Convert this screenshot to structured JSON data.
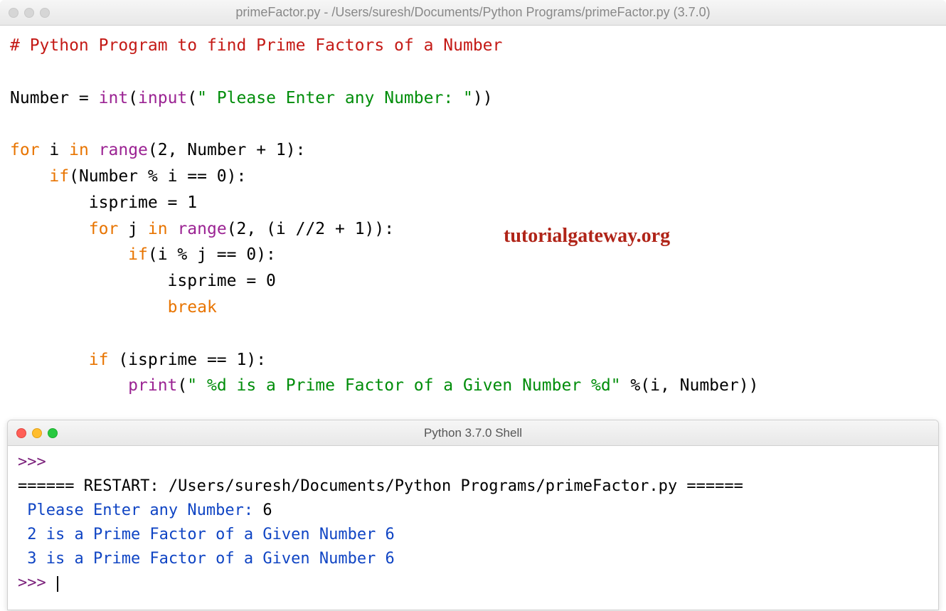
{
  "editor": {
    "title": "primeFactor.py - /Users/suresh/Documents/Python Programs/primeFactor.py (3.7.0)",
    "code": {
      "comment": "# Python Program to find Prime Factors of a Number",
      "l3_a": "Number = ",
      "l3_b": "int",
      "l3_c": "(",
      "l3_d": "input",
      "l3_e": "(",
      "l3_f": "\" Please Enter any Number: \"",
      "l3_g": "))",
      "l5_a": "for",
      "l5_b": " i ",
      "l5_c": "in",
      "l5_d": " ",
      "l5_e": "range",
      "l5_f": "(2, Number + 1):",
      "l6_a": "    ",
      "l6_b": "if",
      "l6_c": "(Number % i == 0):",
      "l7": "        isprime = 1",
      "l8_a": "        ",
      "l8_b": "for",
      "l8_c": " j ",
      "l8_d": "in",
      "l8_e": " ",
      "l8_f": "range",
      "l8_g": "(2, (i //2 + 1)):",
      "l9_a": "            ",
      "l9_b": "if",
      "l9_c": "(i % j == 0):",
      "l10": "                isprime = 0",
      "l11_a": "                ",
      "l11_b": "break",
      "l13_a": "        ",
      "l13_b": "if",
      "l13_c": " (isprime == 1):",
      "l14_a": "            ",
      "l14_b": "print",
      "l14_c": "(",
      "l14_d": "\" %d is a Prime Factor of a Given Number %d\"",
      "l14_e": " %(i, Number))"
    }
  },
  "shell": {
    "title": "Python 3.7.0 Shell",
    "prompt1": ">>> ",
    "restart": "====== RESTART: /Users/suresh/Documents/Python Programs/primeFactor.py ======",
    "line3a": " Please Enter any Number: ",
    "line3b": "6",
    "line4": " 2 is a Prime Factor of a Given Number 6",
    "line5": " 3 is a Prime Factor of a Given Number 6",
    "prompt2": ">>> "
  },
  "watermark": "tutorialgateway.org"
}
